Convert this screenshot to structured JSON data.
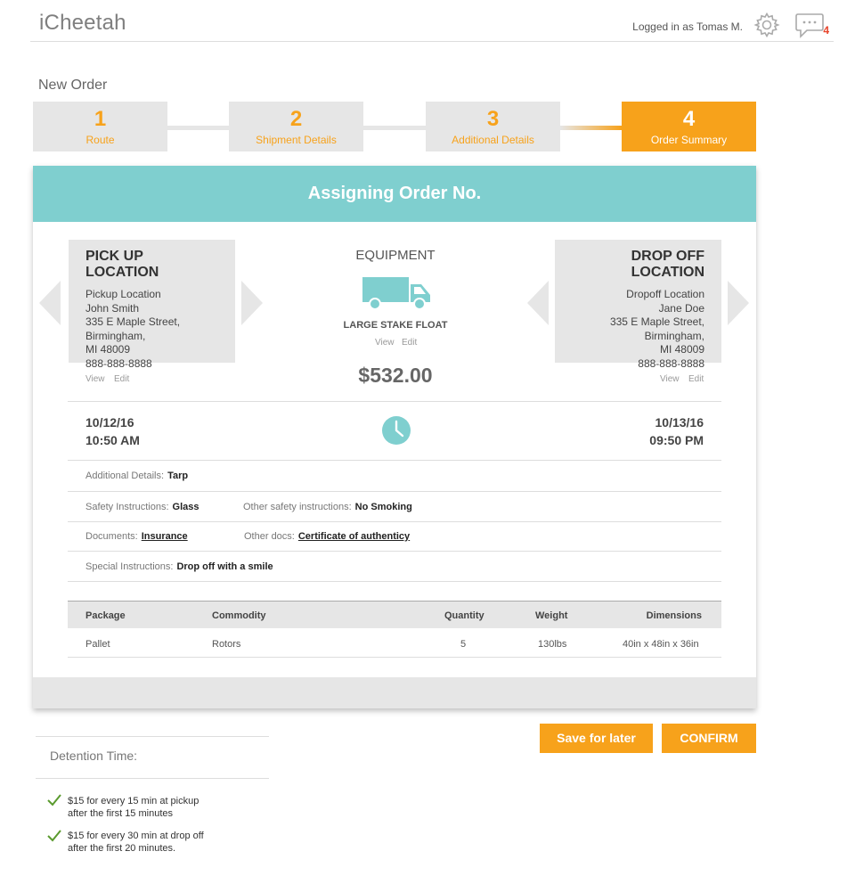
{
  "app": {
    "title": "iCheetah",
    "logged_in": "Logged in as Tomas M.",
    "message_count": "4"
  },
  "page": {
    "title": "New Order"
  },
  "steps": [
    {
      "num": "1",
      "label": "Route"
    },
    {
      "num": "2",
      "label": "Shipment Details"
    },
    {
      "num": "3",
      "label": "Additional Details"
    },
    {
      "num": "4",
      "label": "Order Summary"
    }
  ],
  "card": {
    "header": "Assigning Order No."
  },
  "pickup": {
    "title": "PICK UP LOCATION",
    "lines": [
      "Pickup Location",
      "John Smith",
      "335 E Maple Street,",
      "Birmingham,",
      "MI 48009",
      "888-888-8888"
    ],
    "view": "View",
    "edit": "Edit",
    "date": "10/12/16",
    "time": "10:50 AM"
  },
  "equipment": {
    "title": "EQUIPMENT",
    "name": "LARGE STAKE FLOAT",
    "view": "View",
    "edit": "Edit",
    "price": "$532.00"
  },
  "dropoff": {
    "title": "DROP OFF LOCATION",
    "lines": [
      "Dropoff Location",
      "Jane Doe",
      "335 E Maple Street,",
      "Birmingham,",
      "MI 48009",
      "888-888-8888"
    ],
    "view": "View",
    "edit": "Edit",
    "date": "10/13/16",
    "time": "09:50 PM"
  },
  "details": {
    "additional_label": "Additional Details:",
    "additional_value": "Tarp",
    "safety_label": "Safety Instructions:",
    "safety_value": "Glass",
    "other_safety_label": "Other safety instructions:",
    "other_safety_value": "No Smoking",
    "documents_label": "Documents:",
    "documents_value": "Insurance",
    "other_docs_label": "Other docs:",
    "other_docs_value": "Certificate of authenticy",
    "special_label": "Special Instructions:",
    "special_value": "Drop off with a smile"
  },
  "table": {
    "headers": [
      "Package",
      "Commodity",
      "Quantity",
      "Weight",
      "Dimensions"
    ],
    "rows": [
      [
        "Pallet",
        "Rotors",
        "5",
        "130lbs",
        "40in x 48in x 36in"
      ]
    ]
  },
  "buttons": {
    "save": "Save for later",
    "confirm": "CONFIRM"
  },
  "detention": {
    "label": "Detention Time:",
    "notes": [
      [
        "$15 for every 15 min at pickup",
        "after the first 15 minutes"
      ],
      [
        "$15 for every 30 min at drop off",
        "after the first 20 minutes."
      ]
    ]
  },
  "colors": {
    "accent": "#f7a21b",
    "teal": "#7fcfcf",
    "panel": "#e6e6e6",
    "badge": "#e8442b",
    "check": "#5a9a2e"
  }
}
